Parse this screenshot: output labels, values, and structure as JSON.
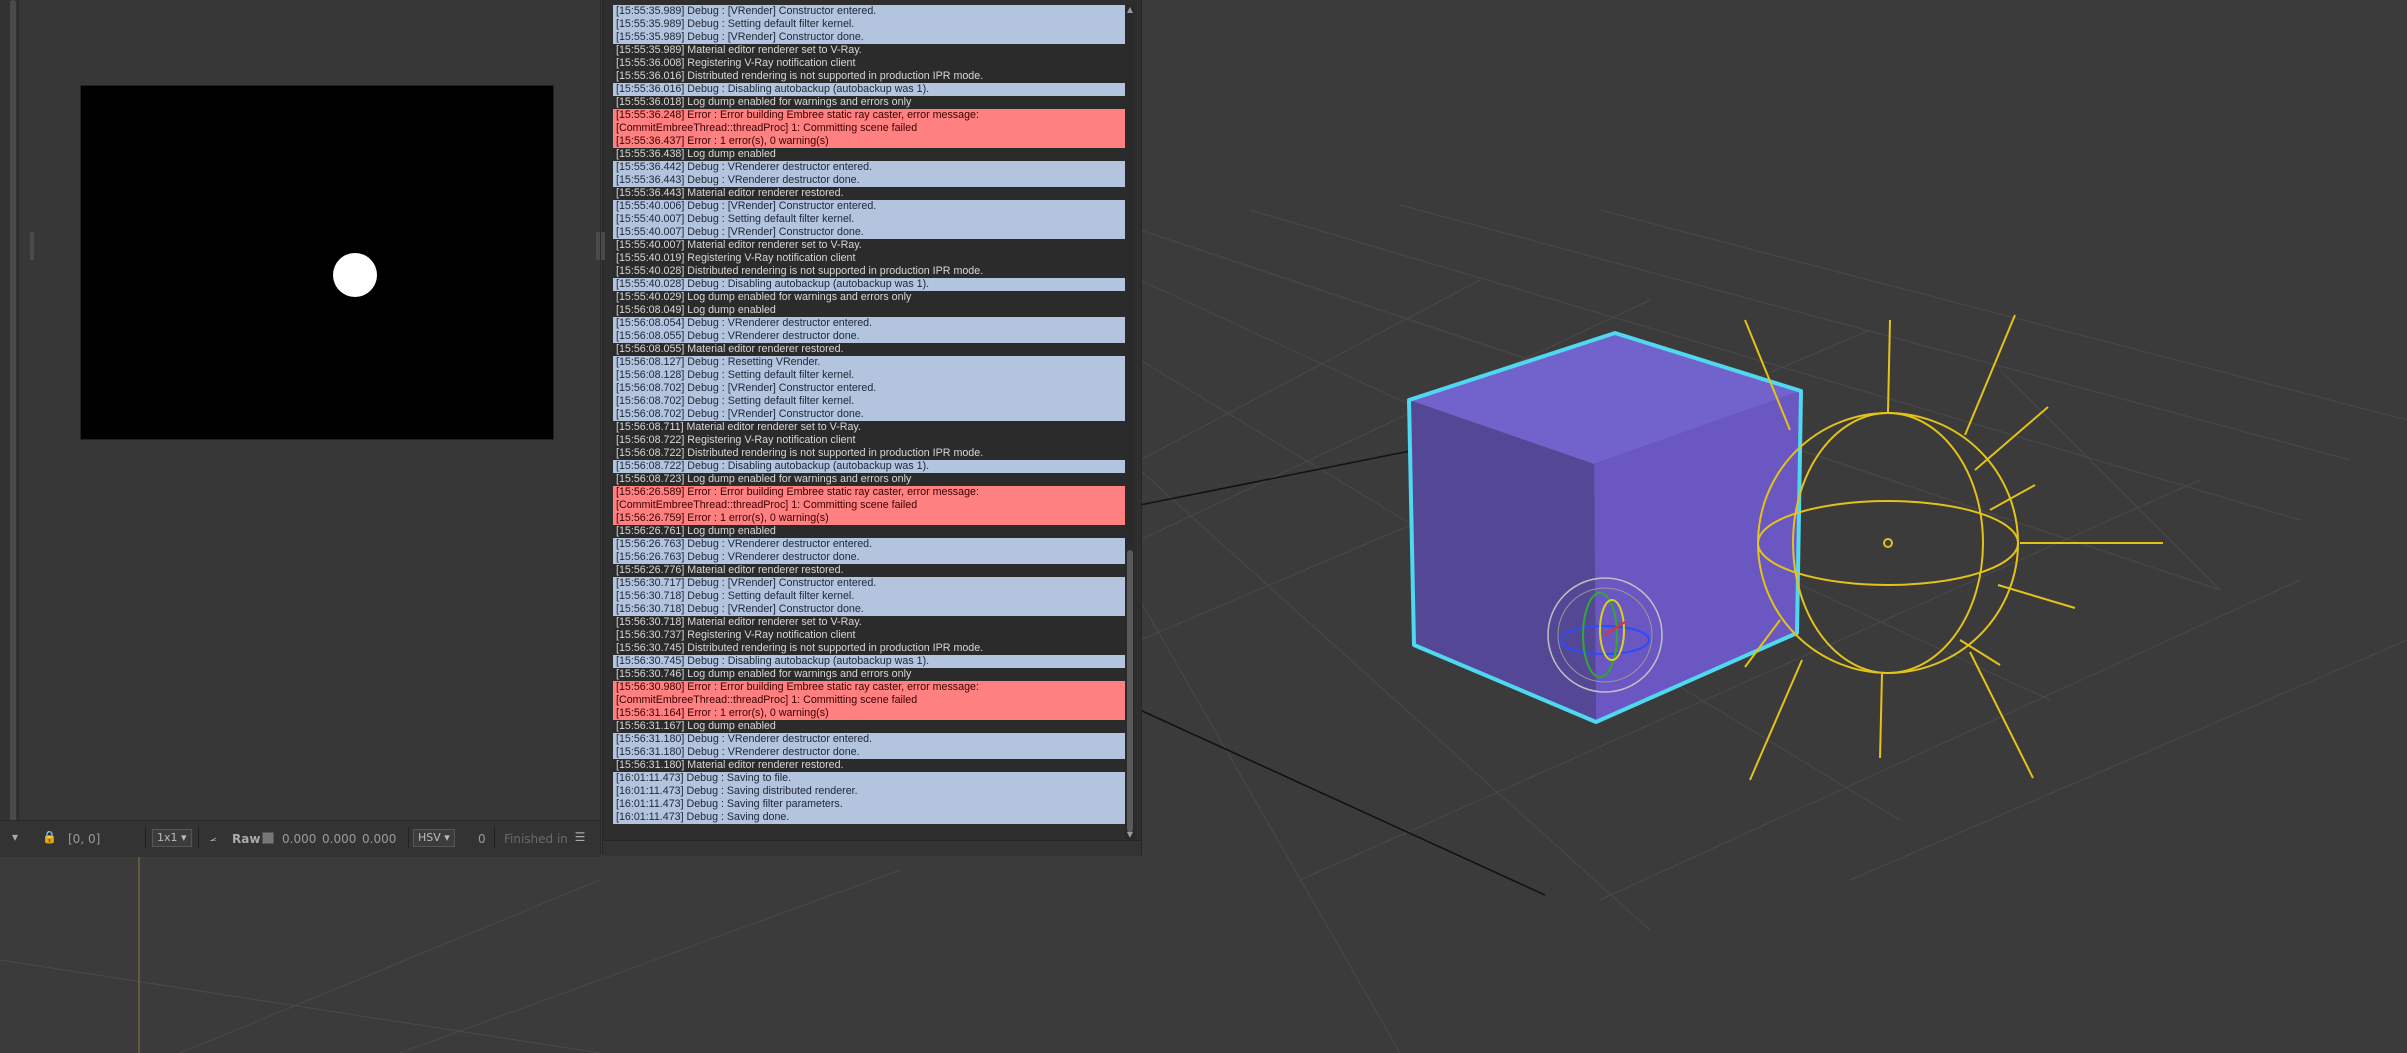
{
  "viewport": {
    "accent_cube": "#6a57c2",
    "accent_selection": "#4fd8ef",
    "light_gizmo_color": "#e3c21a"
  },
  "frame_buffer": {
    "footer": {
      "coords": "[0, 0]",
      "zoom": "1x1",
      "raw_label": "Raw",
      "r": "0.000",
      "g": "0.000",
      "b": "0.000",
      "color_space": "HSV",
      "value": "0",
      "status": "Finished in"
    }
  },
  "log": {
    "entries": [
      {
        "type": "debug",
        "text": "[15:55:35.989] Debug : [VRender] Constructor entered."
      },
      {
        "type": "debug",
        "text": "[15:55:35.989] Debug : Setting default filter kernel."
      },
      {
        "type": "debug",
        "text": "[15:55:35.989] Debug : [VRender] Constructor done."
      },
      {
        "type": "info",
        "text": "[15:55:35.989] Material editor renderer set to V-Ray."
      },
      {
        "type": "info",
        "text": "[15:55:36.008] Registering V-Ray notification client"
      },
      {
        "type": "info",
        "text": "[15:55:36.016] Distributed rendering is not supported in production IPR mode."
      },
      {
        "type": "debug",
        "text": "[15:55:36.016] Debug : Disabling autobackup (autobackup was 1)."
      },
      {
        "type": "info",
        "text": "[15:55:36.018] Log dump enabled for warnings and errors only"
      },
      {
        "type": "error",
        "text": "[15:55:36.248] Error : Error building Embree static ray caster, error message:"
      },
      {
        "type": "error",
        "text": "[CommitEmbreeThread::threadProc] 1: Committing scene failed"
      },
      {
        "type": "error",
        "text": "[15:55:36.437] Error : 1 error(s), 0 warning(s)"
      },
      {
        "type": "info",
        "text": "[15:55:36.438] Log dump enabled"
      },
      {
        "type": "debug",
        "text": "[15:55:36.442] Debug : VRenderer destructor entered."
      },
      {
        "type": "debug",
        "text": "[15:55:36.443] Debug : VRenderer destructor done."
      },
      {
        "type": "info",
        "text": "[15:55:36.443] Material editor renderer restored."
      },
      {
        "type": "debug",
        "text": "[15:55:40.006] Debug : [VRender] Constructor entered."
      },
      {
        "type": "debug",
        "text": "[15:55:40.007] Debug : Setting default filter kernel."
      },
      {
        "type": "debug",
        "text": "[15:55:40.007] Debug : [VRender] Constructor done."
      },
      {
        "type": "info",
        "text": "[15:55:40.007] Material editor renderer set to V-Ray."
      },
      {
        "type": "info",
        "text": "[15:55:40.019] Registering V-Ray notification client"
      },
      {
        "type": "info",
        "text": "[15:55:40.028] Distributed rendering is not supported in production IPR mode."
      },
      {
        "type": "debug",
        "text": "[15:55:40.028] Debug : Disabling autobackup (autobackup was 1)."
      },
      {
        "type": "info",
        "text": "[15:55:40.029] Log dump enabled for warnings and errors only"
      },
      {
        "type": "info",
        "text": "[15:56:08.049] Log dump enabled"
      },
      {
        "type": "debug",
        "text": "[15:56:08.054] Debug : VRenderer destructor entered."
      },
      {
        "type": "debug",
        "text": "[15:56:08.055] Debug : VRenderer destructor done."
      },
      {
        "type": "info",
        "text": "[15:56:08.055] Material editor renderer restored."
      },
      {
        "type": "debug",
        "text": "[15:56:08.127] Debug : Resetting VRender."
      },
      {
        "type": "debug",
        "text": "[15:56:08.128] Debug : Setting default filter kernel."
      },
      {
        "type": "debug",
        "text": "[15:56:08.702] Debug : [VRender] Constructor entered."
      },
      {
        "type": "debug",
        "text": "[15:56:08.702] Debug : Setting default filter kernel."
      },
      {
        "type": "debug",
        "text": "[15:56:08.702] Debug : [VRender] Constructor done."
      },
      {
        "type": "info",
        "text": "[15:56:08.711] Material editor renderer set to V-Ray."
      },
      {
        "type": "info",
        "text": "[15:56:08.722] Registering V-Ray notification client"
      },
      {
        "type": "info",
        "text": "[15:56:08.722] Distributed rendering is not supported in production IPR mode."
      },
      {
        "type": "debug",
        "text": "[15:56:08.722] Debug : Disabling autobackup (autobackup was 1)."
      },
      {
        "type": "info",
        "text": "[15:56:08.723] Log dump enabled for warnings and errors only"
      },
      {
        "type": "error",
        "text": "[15:56:26.589] Error : Error building Embree static ray caster, error message:"
      },
      {
        "type": "error",
        "text": "[CommitEmbreeThread::threadProc] 1: Committing scene failed"
      },
      {
        "type": "error",
        "text": "[15:56:26.759] Error : 1 error(s), 0 warning(s)"
      },
      {
        "type": "info",
        "text": "[15:56:26.761] Log dump enabled"
      },
      {
        "type": "debug",
        "text": "[15:56:26.763] Debug : VRenderer destructor entered."
      },
      {
        "type": "debug",
        "text": "[15:56:26.763] Debug : VRenderer destructor done."
      },
      {
        "type": "info",
        "text": "[15:56:26.776] Material editor renderer restored."
      },
      {
        "type": "debug",
        "text": "[15:56:30.717] Debug : [VRender] Constructor entered."
      },
      {
        "type": "debug",
        "text": "[15:56:30.718] Debug : Setting default filter kernel."
      },
      {
        "type": "debug",
        "text": "[15:56:30.718] Debug : [VRender] Constructor done."
      },
      {
        "type": "info",
        "text": "[15:56:30.718] Material editor renderer set to V-Ray."
      },
      {
        "type": "info",
        "text": "[15:56:30.737] Registering V-Ray notification client"
      },
      {
        "type": "info",
        "text": "[15:56:30.745] Distributed rendering is not supported in production IPR mode."
      },
      {
        "type": "debug",
        "text": "[15:56:30.745] Debug : Disabling autobackup (autobackup was 1)."
      },
      {
        "type": "info",
        "text": "[15:56:30.746] Log dump enabled for warnings and errors only"
      },
      {
        "type": "error",
        "text": "[15:56:30.980] Error : Error building Embree static ray caster, error message:"
      },
      {
        "type": "error",
        "text": "[CommitEmbreeThread::threadProc] 1: Committing scene failed"
      },
      {
        "type": "error",
        "text": "[15:56:31.164] Error : 1 error(s), 0 warning(s)"
      },
      {
        "type": "info",
        "text": "[15:56:31.167] Log dump enabled"
      },
      {
        "type": "debug",
        "text": "[15:56:31.180] Debug : VRenderer destructor entered."
      },
      {
        "type": "debug",
        "text": "[15:56:31.180] Debug : VRenderer destructor done."
      },
      {
        "type": "info",
        "text": "[15:56:31.180] Material editor renderer restored."
      },
      {
        "type": "debug",
        "text": "[16:01:11.473] Debug : Saving to file."
      },
      {
        "type": "debug",
        "text": "[16:01:11.473] Debug : Saving distributed renderer."
      },
      {
        "type": "debug",
        "text": "[16:01:11.473] Debug : Saving filter parameters."
      },
      {
        "type": "debug",
        "text": "[16:01:11.473] Debug : Saving done."
      }
    ]
  }
}
